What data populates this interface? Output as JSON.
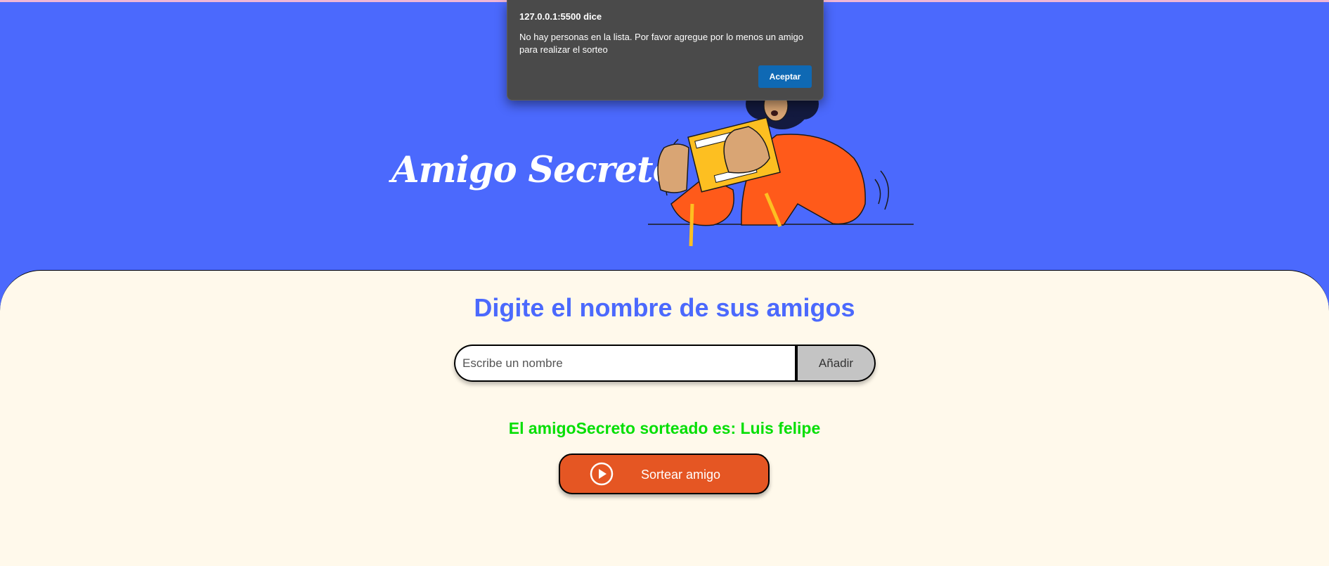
{
  "header": {
    "title": "Amigo Secreto"
  },
  "main": {
    "subtitle": "Digite el nombre de sus amigos",
    "input": {
      "placeholder": "Escribe un nombre",
      "value": ""
    },
    "add_button_label": "Añadir",
    "result_text": "El amigoSecreto sorteado es: Luis felipe",
    "draw_button_label": "Sortear amigo",
    "draw_button_icon": "play-circle-icon"
  },
  "dialog": {
    "title": "127.0.0.1:5500 dice",
    "message": "No hay personas en la lista. Por favor agregue por lo menos un amigo para realizar el sorteo",
    "ok_label": "Aceptar"
  },
  "colors": {
    "header_bg": "#4b69fd",
    "main_bg": "#fff9eb",
    "subtitle": "#4b69fd",
    "result": "#05df05",
    "draw_button": "#e55623",
    "dialog_bg": "#4a4a4a",
    "dialog_button": "#0f69b4"
  }
}
